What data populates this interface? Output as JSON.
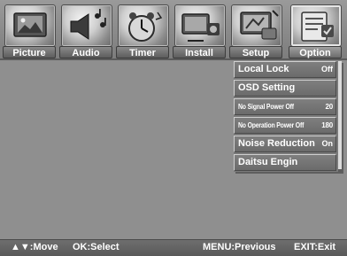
{
  "tabs": [
    {
      "label": "Picture",
      "icon": "picture-icon"
    },
    {
      "label": "Audio",
      "icon": "audio-icon"
    },
    {
      "label": "Timer",
      "icon": "timer-icon"
    },
    {
      "label": "Install",
      "icon": "install-icon"
    },
    {
      "label": "Setup",
      "icon": "setup-icon"
    },
    {
      "label": "Option",
      "icon": "option-icon",
      "active": true
    }
  ],
  "menu": {
    "items": [
      {
        "label": "Local Lock",
        "value": "Off"
      },
      {
        "label": "OSD Setting",
        "value": ""
      },
      {
        "label": "No Signal Power Off",
        "value": "20"
      },
      {
        "label": "No Operation Power Off",
        "value": "180"
      },
      {
        "label": "Noise Reduction",
        "value": "On"
      },
      {
        "label": "Daitsu Engin",
        "value": ""
      }
    ]
  },
  "hints": {
    "move": "▲▼:Move",
    "select": "OK:Select",
    "previous": "MENU:Previous",
    "exit": "EXIT:Exit"
  },
  "colors": {
    "background": "#8f8f8f",
    "menu_item": "#7a7a7a",
    "text": "#ffffff"
  }
}
